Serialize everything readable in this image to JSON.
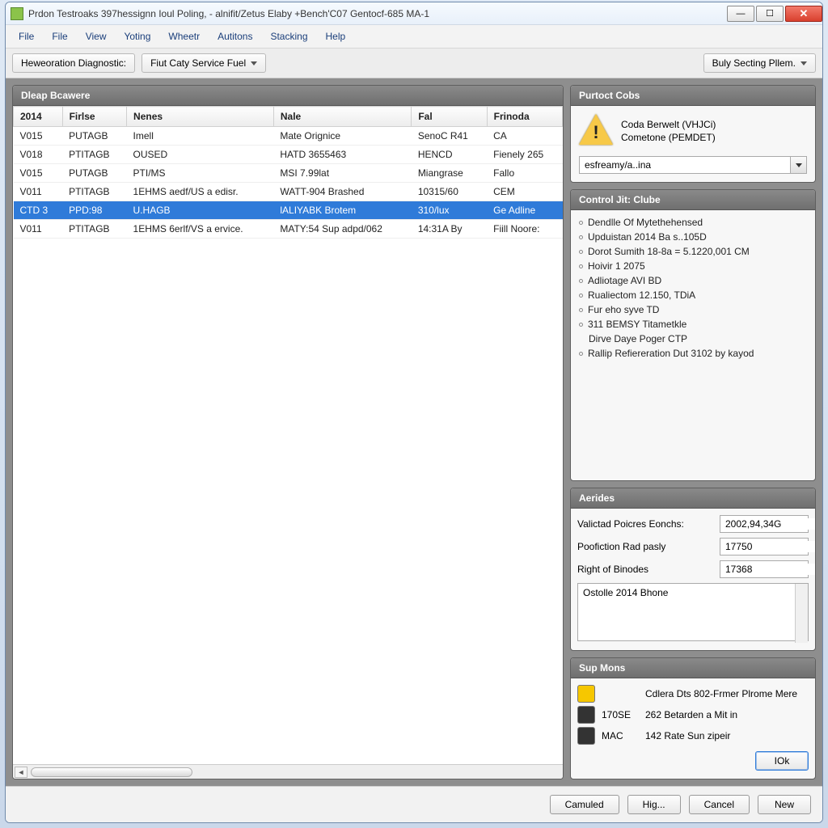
{
  "window": {
    "title": "Prdon Testroaks 397hessignn Ioul Poling, - alnifit/Zetus Elaby +Bench'C07 Gentocf-685 MA-1"
  },
  "menu": [
    "File",
    "File",
    "View",
    "Yoting",
    "Wheetr",
    "Autitons",
    "Stacking",
    "Help"
  ],
  "toolbar": {
    "diag_label": "Heweoration Diagnostic:",
    "service_label": "Fiut Caty Service Fuel",
    "right_label": "Buly Secting Pllem."
  },
  "table": {
    "title": "Dleap Bcawere",
    "cols": [
      "2014",
      "Firlse",
      "Nenes",
      "Nale",
      "Fal",
      "Frinoda"
    ],
    "rows": [
      [
        "V015",
        "PUTAGB",
        "Imell",
        "Mate Orignice",
        "SenoC R41",
        "CA"
      ],
      [
        "V018",
        "PTITAGB",
        "OUSED",
        "HATD 3655463",
        "HENCD",
        "Fienely 265"
      ],
      [
        "V015",
        "PUTAGB",
        "PTI/MS",
        "MSI 7.99lat",
        "Miangrase",
        "Fallo"
      ],
      [
        "V011",
        "PTITAGB",
        "1EHMS aedf/US a edisr.",
        "WATT-904 Brashed",
        "10315/60",
        "CEM"
      ],
      [
        "CTD 3",
        "PPD:98",
        "U.HAGB",
        "lALIYABK Brotem",
        "310/lux",
        "Ge Adline"
      ],
      [
        "V011",
        "PTITAGB",
        "1EHMS 6erlf/VS a ervice.",
        "MATY:54 Sup adpd/062",
        "14:31A By",
        "Fiill Noore:"
      ]
    ],
    "selected_index": 4
  },
  "purtoct": {
    "title": "Purtoct Cobs",
    "line1": "Coda Berwelt (VHJCi)",
    "line2": "Cometone (PEMDET)",
    "combo_value": "esfreamy/a..ina"
  },
  "control": {
    "title": "Control Jit: Clube",
    "items": [
      "Dendlle Of Mytethehensed",
      "Upduistan 2014 Ba s..105D",
      "Dorot Sumith 18-8a = 5.1220,001 CM",
      "Hoivir 1 2075",
      "Adliotage AVI BD",
      "Rualiectom 12.150, TDiA",
      "Fur eho syve TD",
      "311 BEMSY Titametkle"
    ],
    "plain": "Dirve Daye Poger CTP",
    "trailing": "Rallip Refiereration Dut 3102 by kayod"
  },
  "aerides": {
    "title": "Aerides",
    "fields": [
      {
        "label": "Valictad Poicres Eonchs:",
        "value": "2002,94,34G"
      },
      {
        "label": "Poofiction Rad pasly",
        "value": "17750"
      },
      {
        "label": "Right of Binodes",
        "value": "17368"
      }
    ],
    "notes": "Ostolle 2014 Bhone"
  },
  "supmons": {
    "title": "Sup Mons",
    "rows": [
      {
        "code": "",
        "text": "Cdlera Dts 802-Frmer Plrome Mere",
        "icon": "y"
      },
      {
        "code": "170SE",
        "text": "262 Betarden a Mit in",
        "icon": "d"
      },
      {
        "code": "MAC",
        "text": "142 Rate Sun zipeir",
        "icon": "d"
      }
    ],
    "ok": "IOk"
  },
  "footer": [
    "Camuled",
    "Hig...",
    "Cancel",
    "New"
  ]
}
